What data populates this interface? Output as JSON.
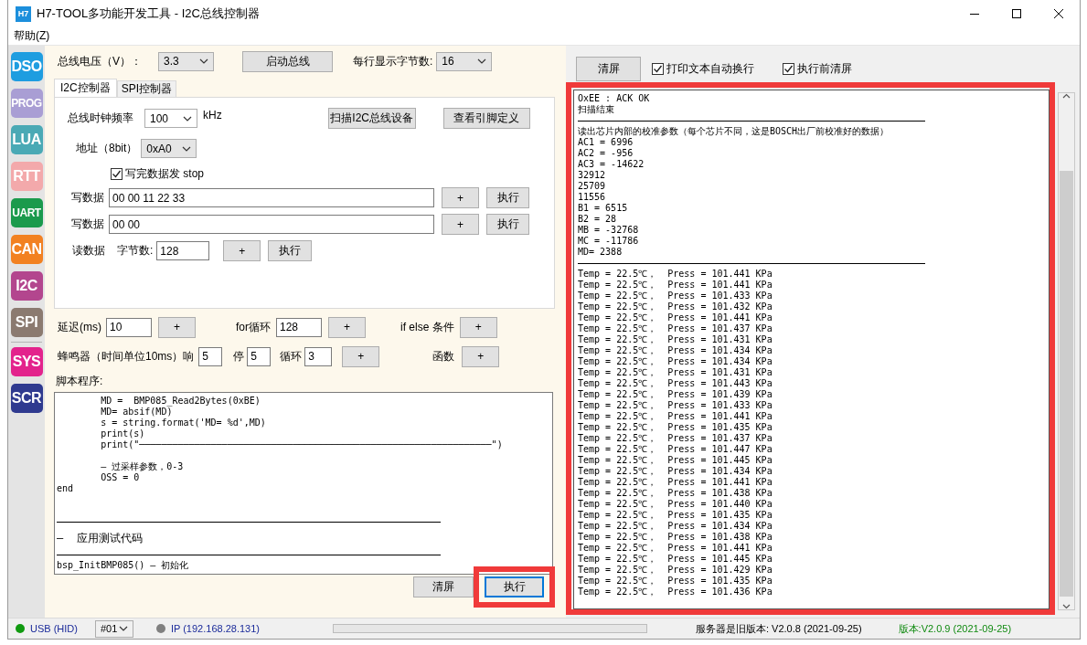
{
  "window": {
    "title": "H7-TOOL多功能开发工具 - I2C总线控制器",
    "app_icon": "H7"
  },
  "menu": [
    {
      "label": "帮助(Z)"
    }
  ],
  "sidebar": {
    "tools": [
      {
        "label": "DSO",
        "color": "#1e9de0"
      },
      {
        "label": "PROG",
        "color": "#a99ed4"
      },
      {
        "label": "LUA",
        "color": "#4aa9b5"
      },
      {
        "label": "RTT",
        "color": "#f3a9ab"
      },
      {
        "label": "UART",
        "color": "#1b9a4c"
      },
      {
        "label": "CAN",
        "color": "#f28121"
      },
      {
        "label": "I2C",
        "color": "#b3468e"
      },
      {
        "label": "SPI",
        "color": "#8b7a70"
      }
    ],
    "system": [
      {
        "label": "SYS",
        "color": "#e3238c"
      },
      {
        "label": "SCR",
        "color": "#2f3a8f"
      }
    ]
  },
  "top_bar": {
    "voltage_label": "总线电压（V）：",
    "voltage": "3.3",
    "start_button": "启动总线",
    "bytes_label": "每行显示字节数:",
    "bytes_per_line": "16"
  },
  "tabs": [
    {
      "label": "I2C控制器",
      "selected": true
    },
    {
      "label": "SPI控制器",
      "selected": false
    }
  ],
  "i2c": {
    "clock_label": "总线时钟频率",
    "clock": "100",
    "clock_unit": "kHz",
    "scan_button": "扫描I2C总线设备",
    "pins_button": "查看引脚定义",
    "address_label": "地址（8bit）",
    "address": "0xA0",
    "stop_checkbox": {
      "label": "写完数据发 stop",
      "checked": true
    },
    "write_rows": [
      {
        "label": "写数据",
        "value": "00 00 11 22 33",
        "add": "+",
        "run": "执行"
      },
      {
        "label": "写数据",
        "value": "00 00",
        "add": "+",
        "run": "执行"
      }
    ],
    "read_row": {
      "label": "读数据",
      "count_label": "字节数:",
      "count": "128",
      "add": "+",
      "run": "执行"
    }
  },
  "tool_rows": [
    [
      {
        "kind": "label",
        "text": "延迟(ms)"
      },
      {
        "kind": "field",
        "value": "10"
      },
      {
        "kind": "button",
        "text": "+"
      },
      {
        "kind": "label",
        "text": "for循环"
      },
      {
        "kind": "field",
        "value": "128"
      },
      {
        "kind": "button",
        "text": "+"
      },
      {
        "kind": "label",
        "text": "if else 条件"
      },
      {
        "kind": "button",
        "text": "+"
      }
    ],
    [
      {
        "kind": "label",
        "text": "蜂鸣器（时间单位10ms）响"
      },
      {
        "kind": "field",
        "value": "5"
      },
      {
        "kind": "label",
        "text": "停"
      },
      {
        "kind": "field",
        "value": "5"
      },
      {
        "kind": "label",
        "text": "循环"
      },
      {
        "kind": "field",
        "value": "3"
      },
      {
        "kind": "button",
        "text": "+"
      },
      {
        "kind": "label",
        "text": "函数"
      },
      {
        "kind": "button",
        "text": "+"
      }
    ]
  ],
  "script": {
    "label": "脚本程序:",
    "lines": [
      {
        "kind": "text",
        "text": "        MD =  BMP085_Read2Bytes(0xBE)"
      },
      {
        "kind": "text",
        "text": "        MD= absif(MD)"
      },
      {
        "kind": "text",
        "text": "        s = string.format('MD= %d',MD)"
      },
      {
        "kind": "text",
        "text": "        print(s)"
      },
      {
        "kind": "text",
        "text": "        print(\"────────────────────────────────────────────────────────────────\")"
      },
      {
        "kind": "blank"
      },
      {
        "kind": "text",
        "text": "        — 过采样参数，0-3"
      },
      {
        "kind": "text",
        "text": "        OSS = 0"
      },
      {
        "kind": "text",
        "text": "end"
      },
      {
        "kind": "blank"
      },
      {
        "kind": "blank"
      },
      {
        "kind": "rule"
      },
      {
        "kind": "text",
        "text": "—  应用测试代码"
      },
      {
        "kind": "rule"
      },
      {
        "kind": "text",
        "text": "bsp_InitBMP085() — 初始化"
      }
    ],
    "clear_button": "清屏",
    "run_button": {
      "label": "执行",
      "default": true,
      "highlighted": true
    }
  },
  "output": {
    "clear_button": "清屏",
    "wrap_checkbox": {
      "label": "打印文本自动换行",
      "checked": true
    },
    "clear_before_checkbox": {
      "label": "执行前清屏",
      "checked": true
    },
    "highlighted": true,
    "lines": [
      {
        "kind": "text",
        "text": "OxEE : ACK OK"
      },
      {
        "kind": "text",
        "text": "扫描结束"
      },
      {
        "kind": "rule"
      },
      {
        "kind": "text",
        "text": "读出芯片内部的校准参数（每个芯片不同，这是BOSCH出厂前校准好的数据）"
      },
      {
        "kind": "text",
        "text": "AC1 = 6996"
      },
      {
        "kind": "text",
        "text": "AC2 = -956"
      },
      {
        "kind": "text",
        "text": "AC3 = -14622"
      },
      {
        "kind": "text",
        "text": "32912"
      },
      {
        "kind": "text",
        "text": "25709"
      },
      {
        "kind": "text",
        "text": "11556"
      },
      {
        "kind": "text",
        "text": "B1 = 6515"
      },
      {
        "kind": "text",
        "text": "B2 = 28"
      },
      {
        "kind": "text",
        "text": "MB = -32768"
      },
      {
        "kind": "text",
        "text": "MC = -11786"
      },
      {
        "kind": "text",
        "text": "MD= 2388"
      },
      {
        "kind": "rule"
      },
      {
        "kind": "text",
        "text": "Temp = 22.5℃，  Press = 101.441 KPa"
      },
      {
        "kind": "text",
        "text": "Temp = 22.5℃，  Press = 101.441 KPa"
      },
      {
        "kind": "text",
        "text": "Temp = 22.5℃，  Press = 101.433 KPa"
      },
      {
        "kind": "text",
        "text": "Temp = 22.5℃，  Press = 101.432 KPa"
      },
      {
        "kind": "text",
        "text": "Temp = 22.5℃，  Press = 101.441 KPa"
      },
      {
        "kind": "text",
        "text": "Temp = 22.5℃，  Press = 101.437 KPa"
      },
      {
        "kind": "text",
        "text": "Temp = 22.5℃，  Press = 101.431 KPa"
      },
      {
        "kind": "text",
        "text": "Temp = 22.5℃，  Press = 101.434 KPa"
      },
      {
        "kind": "text",
        "text": "Temp = 22.5℃，  Press = 101.434 KPa"
      },
      {
        "kind": "text",
        "text": "Temp = 22.5℃，  Press = 101.431 KPa"
      },
      {
        "kind": "text",
        "text": "Temp = 22.5℃，  Press = 101.443 KPa"
      },
      {
        "kind": "text",
        "text": "Temp = 22.5℃，  Press = 101.439 KPa"
      },
      {
        "kind": "text",
        "text": "Temp = 22.5℃，  Press = 101.433 KPa"
      },
      {
        "kind": "text",
        "text": "Temp = 22.5℃，  Press = 101.441 KPa"
      },
      {
        "kind": "text",
        "text": "Temp = 22.5℃，  Press = 101.435 KPa"
      },
      {
        "kind": "text",
        "text": "Temp = 22.5℃，  Press = 101.437 KPa"
      },
      {
        "kind": "text",
        "text": "Temp = 22.5℃，  Press = 101.447 KPa"
      },
      {
        "kind": "text",
        "text": "Temp = 22.5℃，  Press = 101.445 KPa"
      },
      {
        "kind": "text",
        "text": "Temp = 22.5℃，  Press = 101.434 KPa"
      },
      {
        "kind": "text",
        "text": "Temp = 22.5℃，  Press = 101.441 KPa"
      },
      {
        "kind": "text",
        "text": "Temp = 22.5℃，  Press = 101.438 KPa"
      },
      {
        "kind": "text",
        "text": "Temp = 22.5℃，  Press = 101.440 KPa"
      },
      {
        "kind": "text",
        "text": "Temp = 22.5℃，  Press = 101.435 KPa"
      },
      {
        "kind": "text",
        "text": "Temp = 22.5℃，  Press = 101.434 KPa"
      },
      {
        "kind": "text",
        "text": "Temp = 22.5℃，  Press = 101.438 KPa"
      },
      {
        "kind": "text",
        "text": "Temp = 22.5℃，  Press = 101.441 KPa"
      },
      {
        "kind": "text",
        "text": "Temp = 22.5℃，  Press = 101.445 KPa"
      },
      {
        "kind": "text",
        "text": "Temp = 22.5℃，  Press = 101.429 KPa"
      },
      {
        "kind": "text",
        "text": "Temp = 22.5℃，  Press = 101.435 KPa"
      },
      {
        "kind": "text",
        "text": "Temp = 22.5℃，  Press = 101.436 KPa"
      }
    ]
  },
  "status_bar": {
    "usb": {
      "label": "USB (HID)",
      "connected": true
    },
    "device": "#01",
    "ip": {
      "label": "IP (192.168.28.131)",
      "connected": false
    },
    "progress": {
      "level": 0
    },
    "server_version": "服务器是旧版本: V2.0.8 (2021-09-25)",
    "version": "版本:V2.0.9 (2021-09-25)"
  }
}
